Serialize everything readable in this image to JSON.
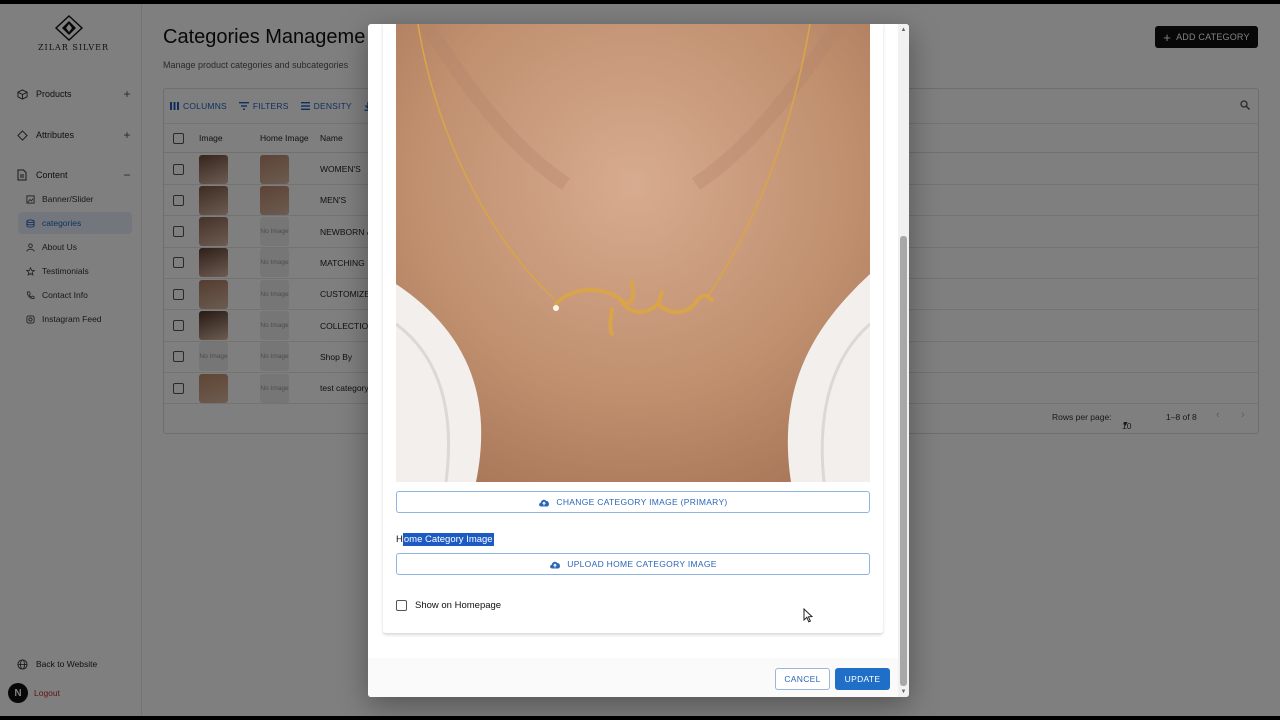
{
  "brand": {
    "logo_text": "ZILAR SILVER"
  },
  "sidebar": {
    "groups": [
      {
        "label": "Products",
        "toggle": "+"
      },
      {
        "label": "Attributes",
        "toggle": "+"
      },
      {
        "label": "Content",
        "toggle": "−"
      }
    ],
    "content_items": [
      {
        "label": "Banner/Slider"
      },
      {
        "label": "categories"
      },
      {
        "label": "About Us"
      },
      {
        "label": "Testimonials"
      },
      {
        "label": "Contact Info"
      },
      {
        "label": "Instagram Feed"
      }
    ],
    "back_label": "Back to Website",
    "logout_label": "Logout",
    "badge_letter": "N"
  },
  "page": {
    "title": "Categories Manageme",
    "subtitle": "Manage product categories and subcategories",
    "add_label": "ADD CATEGORY"
  },
  "grid": {
    "toolbar": {
      "columns": "COLUMNS",
      "filters": "FILTERS",
      "density": "DENSITY"
    },
    "headers": {
      "image": "Image",
      "home_image": "Home Image",
      "name": "Name"
    },
    "no_image_text": "No Image",
    "rows": [
      {
        "name": "WOMEN'S",
        "image": "photo",
        "home_image": "photo"
      },
      {
        "name": "MEN'S",
        "image": "photo",
        "home_image": "photo"
      },
      {
        "name": "NEWBORN &",
        "image": "photo",
        "home_image": "none"
      },
      {
        "name": "MATCHING",
        "image": "photo",
        "home_image": "none"
      },
      {
        "name": "CUSTOMIZE",
        "image": "photo",
        "home_image": "none"
      },
      {
        "name": "COLLECTIO",
        "image": "photo",
        "home_image": "none"
      },
      {
        "name": "Shop By",
        "image": "none",
        "home_image": "none"
      },
      {
        "name": "test category",
        "image": "photo",
        "home_image": "none"
      }
    ],
    "footer": {
      "rows_per_page_label": "Rows per page:",
      "rows_per_page_value": "10",
      "range": "1–8 of 8"
    }
  },
  "dialog": {
    "change_primary_label": "CHANGE CATEGORY IMAGE (PRIMARY)",
    "home_label_first": "H",
    "home_label_rest": "ome Category Image",
    "upload_home_label": "UPLOAD HOME CATEGORY IMAGE",
    "show_on_homepage_label": "Show on Homepage",
    "cancel_label": "CANCEL",
    "update_label": "UPDATE"
  },
  "colors": {
    "accent": "#1f6fc9",
    "link": "#2a66b8",
    "selection": "#1c5ac4",
    "logout": "#c62828",
    "skin": "#c89c80",
    "gold": "#d9a44a"
  }
}
